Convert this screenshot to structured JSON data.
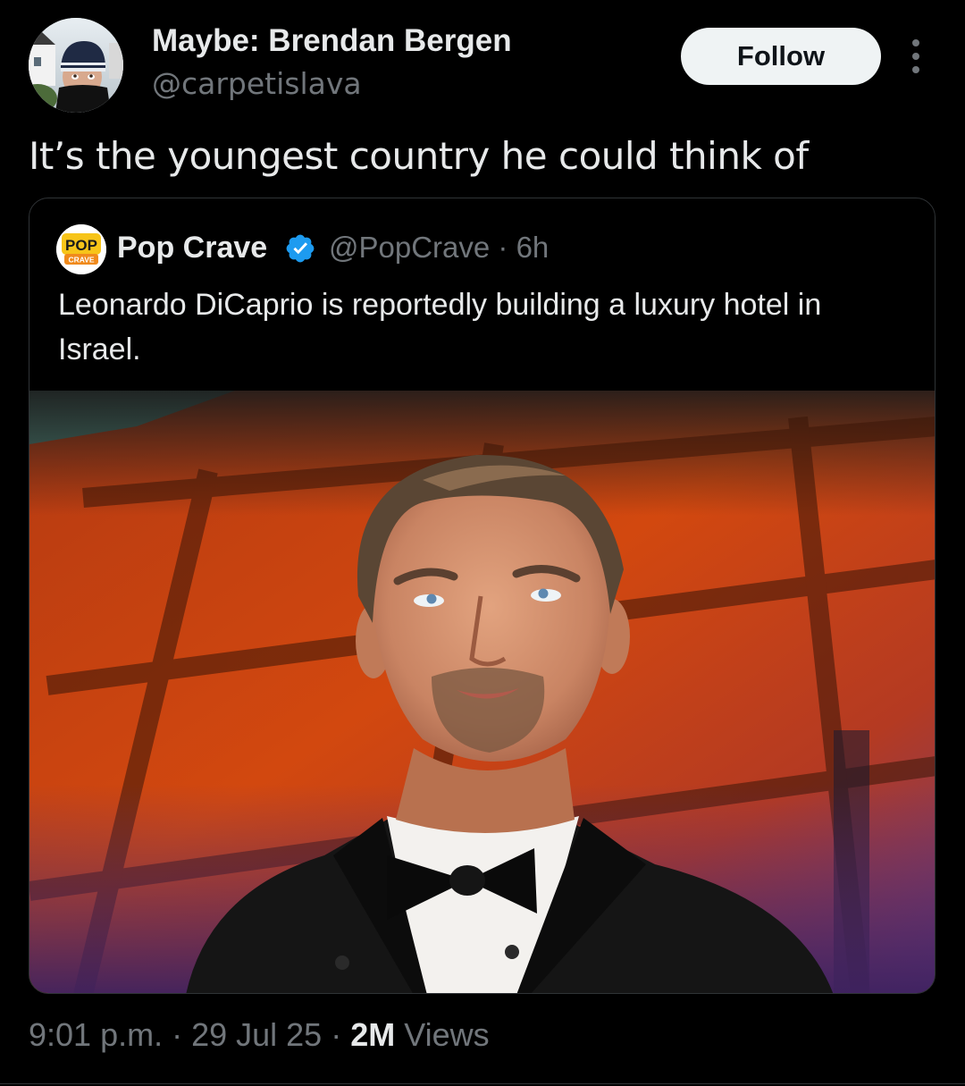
{
  "author": {
    "display_name": "Maybe: Brendan Bergen",
    "handle": "@carpetislava",
    "follow_label": "Follow"
  },
  "tweet": {
    "text": "It’s the youngest country he could think of"
  },
  "quoted_tweet": {
    "display_name": "Pop Crave",
    "verified": true,
    "handle_time": "@PopCrave · 6h",
    "text": "Leonardo DiCaprio is reportedly building a luxury hotel in Israel.",
    "avatar_logo_top": "POP",
    "avatar_logo_bottom": "CRAVE",
    "media_description_icon": "photo"
  },
  "meta": {
    "time": "9:01 p.m.",
    "separator": " · ",
    "date": "29 Jul 25",
    "views_count": "2M",
    "views_label": " Views"
  },
  "colors": {
    "background": "#000000",
    "text_primary": "#e7e9ea",
    "text_secondary": "#71767b",
    "border": "#2f3336",
    "verified_blue": "#1d9bf0",
    "follow_bg": "#eff3f4",
    "popcrave_yellow": "#f7c419",
    "popcrave_orange": "#f08a1c"
  }
}
